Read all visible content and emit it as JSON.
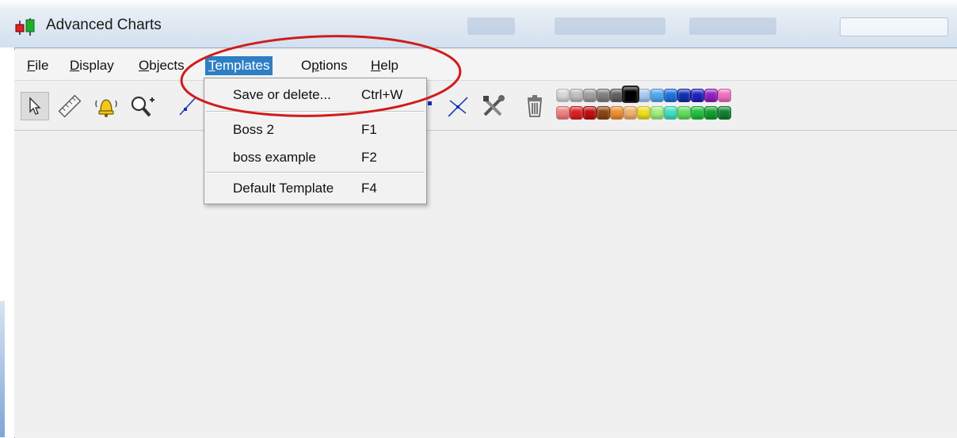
{
  "window": {
    "title": "Advanced Charts"
  },
  "menubar": {
    "items": [
      {
        "label": "File",
        "mnemonic": "F",
        "rest": "ile"
      },
      {
        "label": "Display",
        "mnemonic": "D",
        "rest": "isplay"
      },
      {
        "label": "Objects",
        "mnemonic": "O",
        "rest": "bjects"
      },
      {
        "label": "Templates",
        "mnemonic": "T",
        "rest": "emplates"
      },
      {
        "label": "Options",
        "pre": "O",
        "mnemonic": "p",
        "rest": "tions"
      },
      {
        "label": "Help",
        "mnemonic": "H",
        "rest": "elp"
      }
    ],
    "active": "Templates"
  },
  "templates_menu": {
    "items": [
      {
        "label": "Save or delete...",
        "shortcut": "Ctrl+W"
      },
      {
        "label": "Boss 2",
        "shortcut": "F1"
      },
      {
        "label": "boss example",
        "shortcut": "F2"
      },
      {
        "label": "Default Template",
        "shortcut": "F4"
      }
    ]
  },
  "toolbar": {
    "icons": [
      "pointer-icon",
      "ruler-icon",
      "alarm-bell-icon",
      "zoom-in-icon",
      "trendline-icon",
      "line-tool-icon",
      "intersect-line-icon",
      "tools-icon",
      "trash-icon"
    ],
    "palette_top": [
      "#d8d8d8",
      "#c0c0c0",
      "#a0a0a0",
      "#808080",
      "#606060",
      "#000000",
      "#a8c8f0",
      "#50a8f0",
      "#1f6fe0",
      "#1030b0",
      "#2020c0",
      "#9020c0",
      "#f070c0"
    ],
    "palette_bottom": [
      "#f08080",
      "#e02020",
      "#c01010",
      "#8b4513",
      "#f09030",
      "#f0b070",
      "#f0e020",
      "#a0f080",
      "#40e0c0",
      "#60e060",
      "#20c040",
      "#10a030",
      "#108030"
    ],
    "selected_color": "#000000"
  },
  "annotation": {
    "color": "#d01c1c"
  }
}
